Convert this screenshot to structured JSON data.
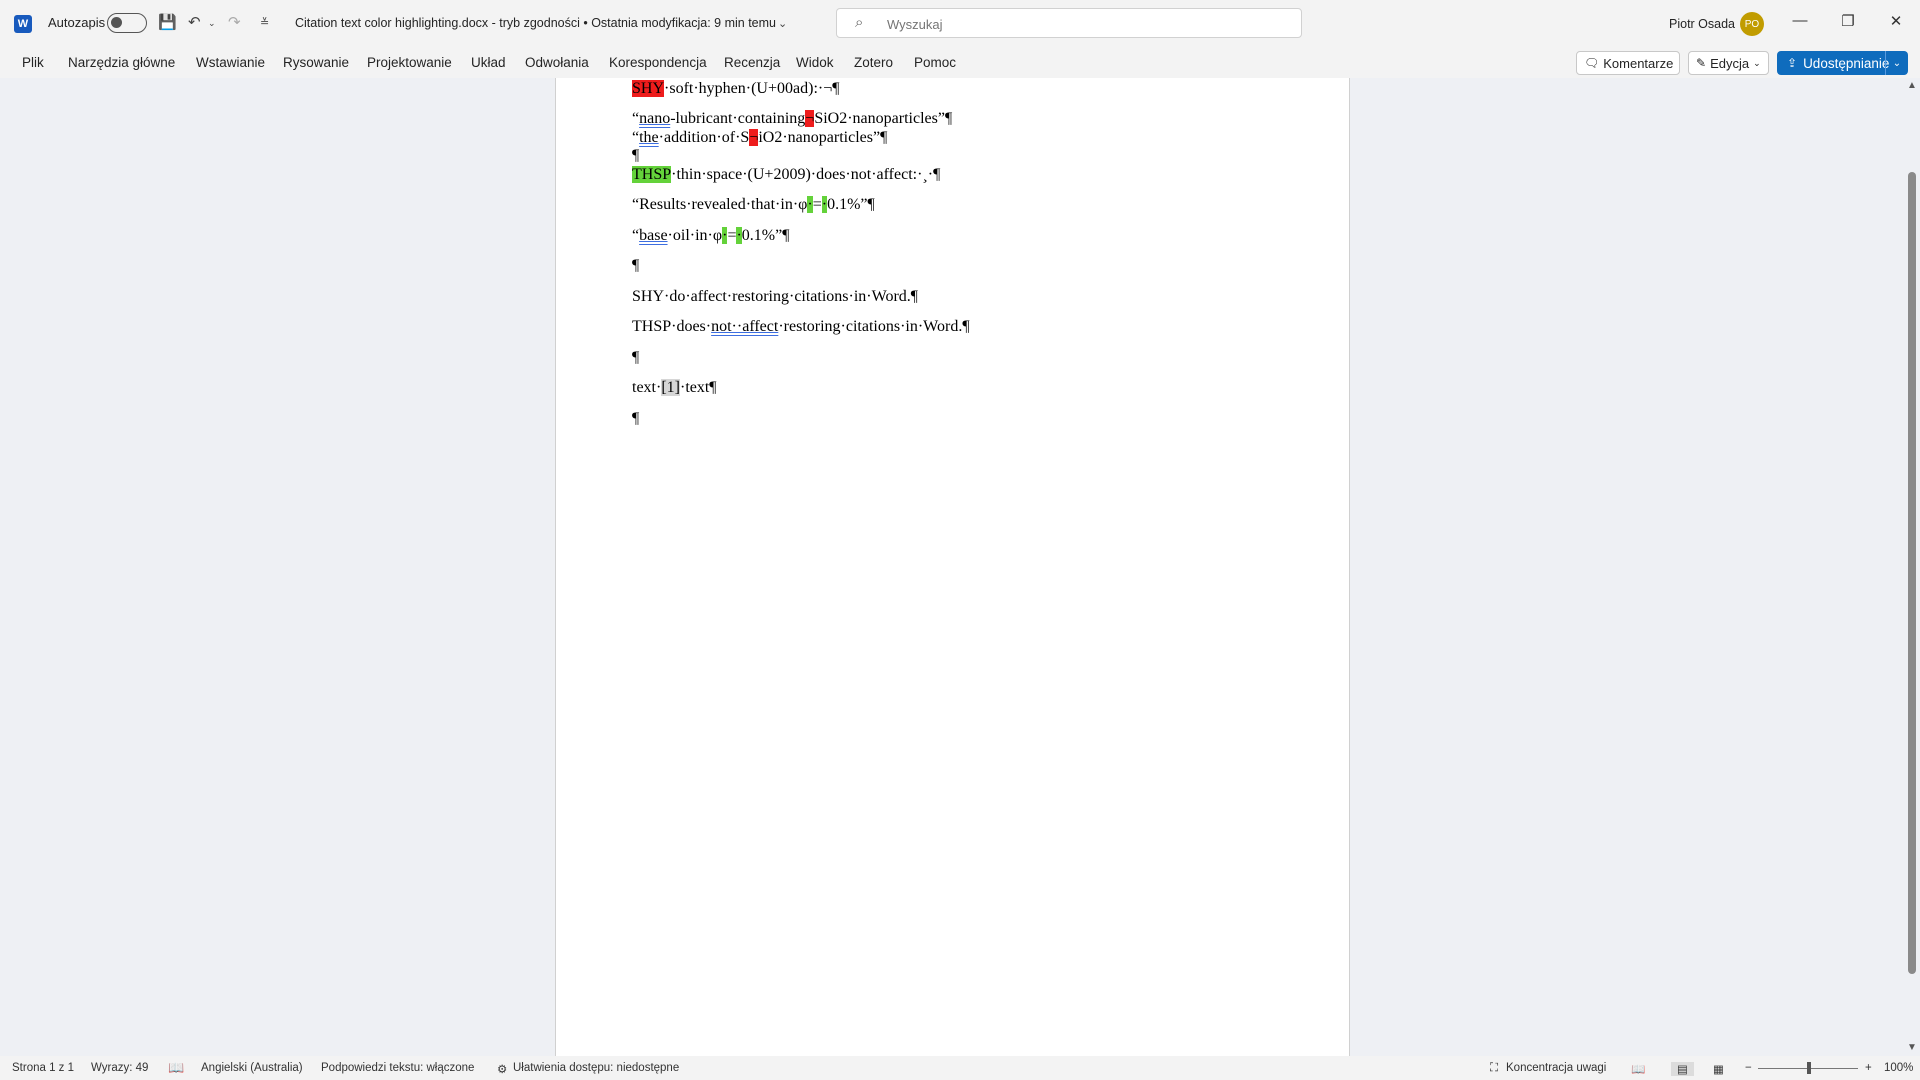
{
  "titlebar": {
    "autosave_label": "Autozapis",
    "doc_title": "Citation text color highlighting.docx  -  tryb zgodności  •  Ostatnia modyfikacja: 9 min temu",
    "search_placeholder": "Wyszukaj",
    "user_name": "Piotr Osada",
    "user_initials": "PO"
  },
  "ribbon": {
    "tabs": [
      "Plik",
      "Narzędzia główne",
      "Wstawianie",
      "Rysowanie",
      "Projektowanie",
      "Układ",
      "Odwołania",
      "Korespondencja",
      "Recenzja",
      "Widok",
      "Zotero",
      "Pomoc"
    ],
    "comments_label": "Komentarze",
    "editing_label": "Edycja",
    "share_label": "Udostępnianie"
  },
  "document": {
    "l1_shy": "SHY",
    "l1_rest": "·soft·hyphen·(U+00ad):·¬¶",
    "l2_a": "“",
    "l2_nano": "nano",
    "l2_b": "-lubricant·containing",
    "l2_hl": "¬",
    "l2_c": "SiO2·nanoparticles”¶",
    "l3_a": "“",
    "l3_the": "the",
    "l3_b": "·addition·of·S",
    "l3_hl": "¬",
    "l3_c": "iO2·nanoparticles”¶",
    "l4": "¶",
    "l5_thsp": "THSP",
    "l5_rest": "·thin·space·(U+2009)·does·not·affect:·¸·¶",
    "l6_a": "“Results·revealed·that·in·φ",
    "l6_hl1": "·",
    "l6_eq": "=",
    "l6_hl2": "·",
    "l6_c": "0.1%”¶",
    "l7_a": "“",
    "l7_base": "base",
    "l7_b": "·oil·in·φ",
    "l7_hl1": "·",
    "l7_eq": "=",
    "l7_hl2": "·",
    "l7_c": "0.1%”¶",
    "l8": "¶",
    "l9": "SHY·do·affect·restoring·citations·in·Word.¶",
    "l10_a": "THSP·does·",
    "l10_sq": "not··affect",
    "l10_b": "·restoring·citations·in·Word.¶",
    "l11": "¶",
    "l12_a": "text·",
    "l12_cite": "[1]",
    "l12_b": "·text¶",
    "l13": "¶"
  },
  "statusbar": {
    "page": "Strona 1 z 1",
    "words": "Wyrazy: 49",
    "language": "Angielski (Australia)",
    "text_predictions": "Podpowiedzi tekstu: włączone",
    "accessibility": "Ułatwienia dostępu: niedostępne",
    "focus": "Koncentracja uwagi",
    "zoom": "100%"
  },
  "colors": {
    "highlight_red": "#ee1c1c",
    "highlight_green": "#64d23a",
    "accent": "#0f6cbd"
  }
}
